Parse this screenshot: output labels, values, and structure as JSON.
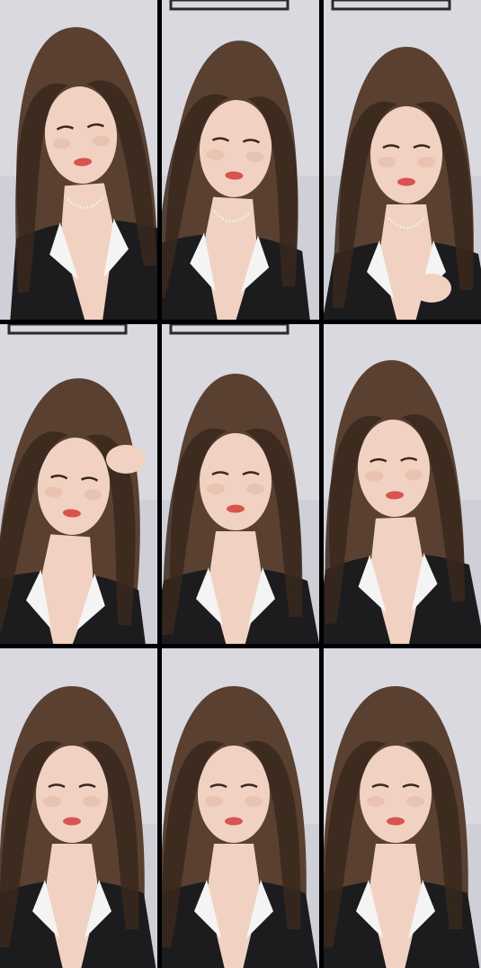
{
  "image": {
    "type": "photo-grid",
    "rows": 3,
    "columns": 3,
    "frame_count": 9,
    "colors": {
      "gutter": "#000000",
      "wall": "#d9d9df",
      "wall_shadow": "#c6c6cf",
      "hair": "#5a4030",
      "hair_dark": "#3a281d",
      "skin": "#f1d2c2",
      "skin_shadow": "#e2b9a5",
      "lips": "#d9534f",
      "shirt": "#1c1c1e",
      "collar": "#f4f4f4",
      "necklace": "#eeeeee",
      "frame_edge": "#2b2b2b"
    }
  },
  "frames": [
    {
      "id": 1,
      "subject": "woman-selfie",
      "collar": "white",
      "necklace": true,
      "picture_frame_top": false,
      "hand_visible": false
    },
    {
      "id": 2,
      "subject": "woman-selfie",
      "collar": "white",
      "necklace": true,
      "picture_frame_top": true,
      "hand_visible": false
    },
    {
      "id": 3,
      "subject": "woman-selfie",
      "collar": "white",
      "necklace": true,
      "picture_frame_top": true,
      "hand_visible": true
    },
    {
      "id": 4,
      "subject": "woman-selfie",
      "collar": "white",
      "necklace": false,
      "picture_frame_top": true,
      "hand_visible": true
    },
    {
      "id": 5,
      "subject": "woman-selfie",
      "collar": "white",
      "necklace": false,
      "picture_frame_top": true,
      "hand_visible": false
    },
    {
      "id": 6,
      "subject": "woman-selfie",
      "collar": "white",
      "necklace": false,
      "picture_frame_top": false,
      "hand_visible": false
    },
    {
      "id": 7,
      "subject": "woman-selfie",
      "collar": "white",
      "necklace": false,
      "picture_frame_top": false,
      "hand_visible": false
    },
    {
      "id": 8,
      "subject": "woman-selfie",
      "collar": "white",
      "necklace": false,
      "picture_frame_top": false,
      "hand_visible": false
    },
    {
      "id": 9,
      "subject": "woman-selfie",
      "collar": "white",
      "necklace": false,
      "picture_frame_top": false,
      "hand_visible": false
    }
  ]
}
